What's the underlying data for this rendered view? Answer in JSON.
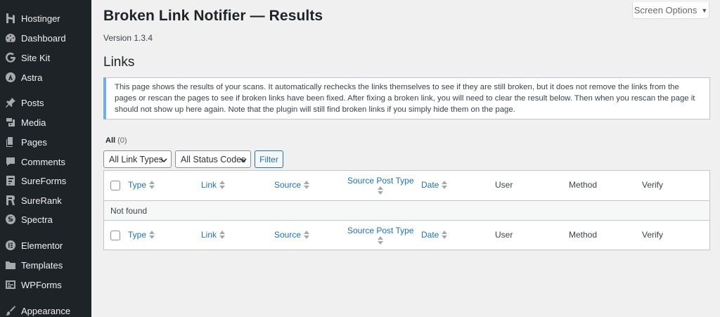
{
  "sidebar": {
    "items": [
      {
        "label": "Hostinger",
        "icon": "hostinger-icon"
      },
      {
        "label": "Dashboard",
        "icon": "dashboard-icon"
      },
      {
        "label": "Site Kit",
        "icon": "sitekit-icon"
      },
      {
        "label": "Astra",
        "icon": "astra-icon"
      },
      {
        "label": "Posts",
        "icon": "pin-icon"
      },
      {
        "label": "Media",
        "icon": "media-icon"
      },
      {
        "label": "Pages",
        "icon": "pages-icon"
      },
      {
        "label": "Comments",
        "icon": "comments-icon"
      },
      {
        "label": "SureForms",
        "icon": "sureforms-icon"
      },
      {
        "label": "SureRank",
        "icon": "surerank-icon"
      },
      {
        "label": "Spectra",
        "icon": "spectra-icon"
      },
      {
        "label": "Elementor",
        "icon": "elementor-icon"
      },
      {
        "label": "Templates",
        "icon": "folder-icon"
      },
      {
        "label": "WPForms",
        "icon": "wpforms-icon"
      },
      {
        "label": "Appearance",
        "icon": "brush-icon"
      }
    ]
  },
  "screen_options": {
    "label": "Screen Options",
    "caret": "▼"
  },
  "header": {
    "title": "Broken Link Notifier — Results",
    "version": "Version 1.3.4",
    "section_heading": "Links"
  },
  "notice": {
    "text": "This page shows the results of your scans. It automatically rechecks the links themselves to see if they are still broken, but it does not remove the links from the pages or rescan the pages to see if broken links have been fixed. After fixing a broken link, you will need to clear the result below. Then when you rescan the page it should not show up here again. Note that the plugin will still find broken links if you simply hide them on the page."
  },
  "views": {
    "all_label": "All",
    "all_count": "(0)"
  },
  "filters": {
    "link_types": "All Link Types",
    "status_codes": "All Status Codes",
    "filter_button": "Filter"
  },
  "table": {
    "columns": {
      "type": "Type",
      "link": "Link",
      "source": "Source",
      "source_post_type": "Source Post Type",
      "date": "Date",
      "user": "User",
      "method": "Method",
      "verify": "Verify"
    },
    "empty_message": "Not found"
  },
  "colors": {
    "sidebar_bg": "#1d2327",
    "link_blue": "#2271b1",
    "notice_border": "#72aee6",
    "page_bg": "#f0f0f1"
  }
}
